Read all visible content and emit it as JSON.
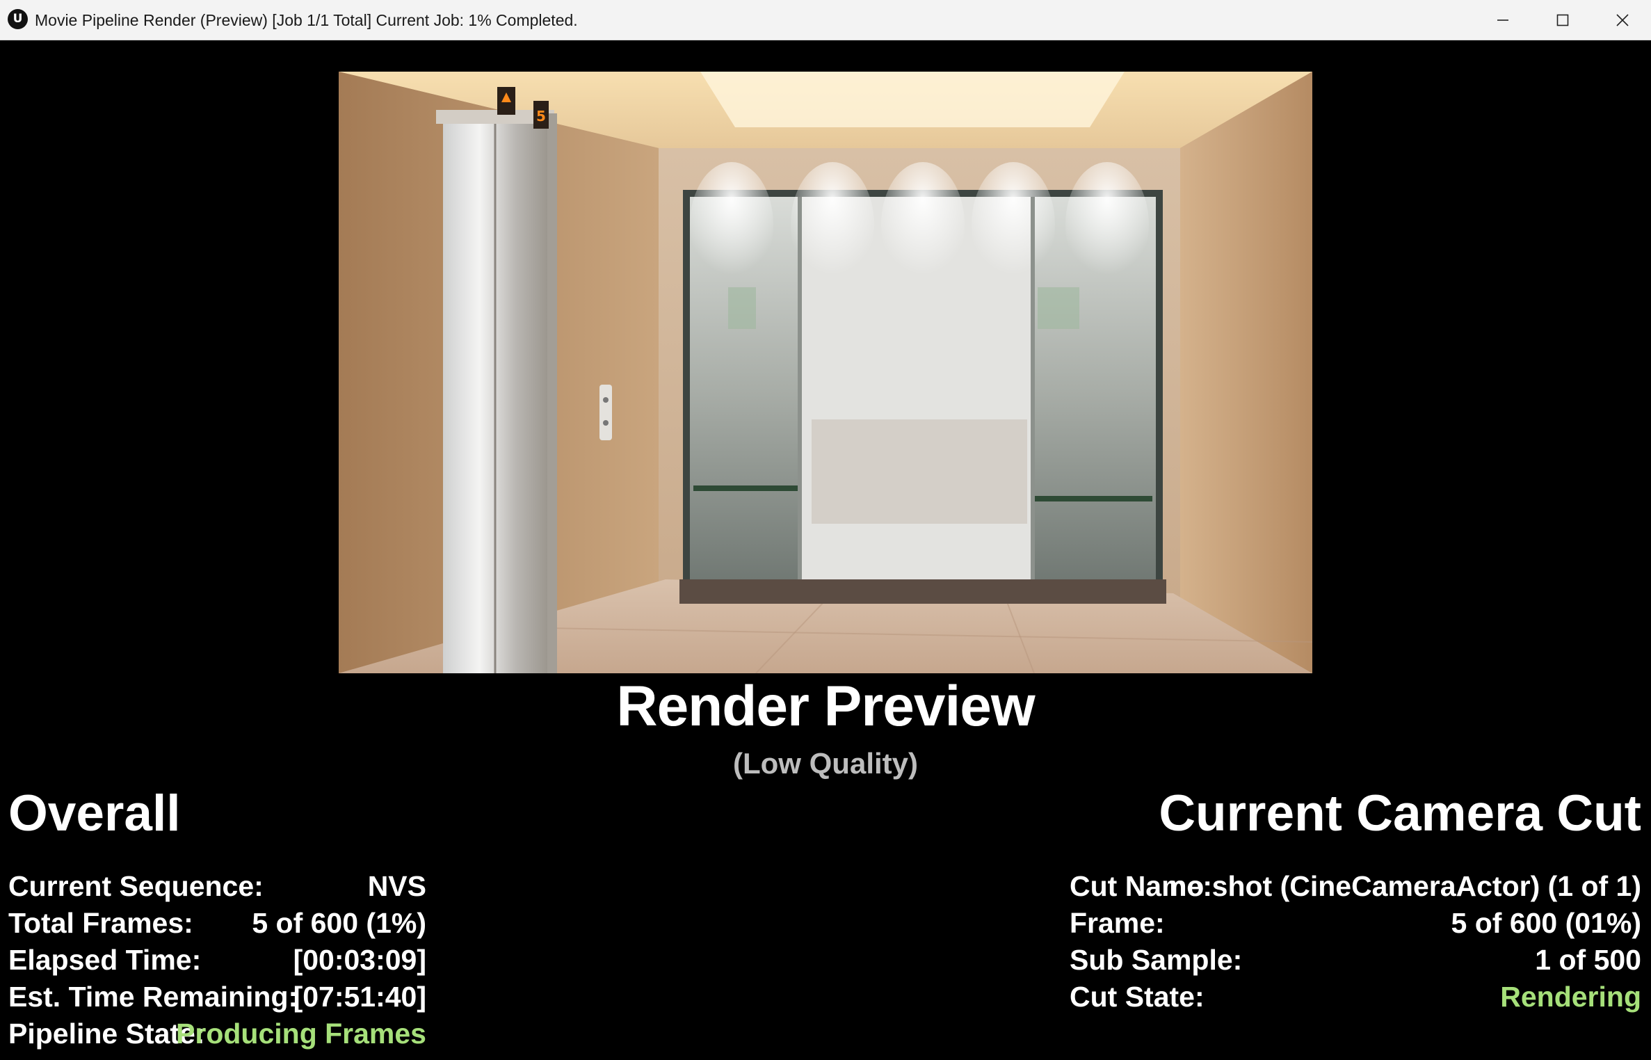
{
  "window": {
    "title": "Movie Pipeline Render (Preview) [Job 1/1 Total] Current Job: 1% Completed.",
    "logo_icon": "unreal-engine-logo-icon",
    "logo_glyph": "U",
    "controls": {
      "minimize_icon": "minimize-icon",
      "maximize_icon": "maximize-icon",
      "close_icon": "close-icon"
    }
  },
  "preview": {
    "title": "Render Preview",
    "subtitle": "(Low Quality)",
    "floor_indicator": "5"
  },
  "overall": {
    "heading": "Overall",
    "rows": [
      {
        "label": "Current Sequence:",
        "value": "NVS"
      },
      {
        "label": "Total Frames:",
        "value": "5 of 600 (1%)"
      },
      {
        "label": "Elapsed Time:",
        "value": "[00:03:09]"
      },
      {
        "label": "Est. Time Remaining:",
        "value": "[07:51:40]"
      },
      {
        "label": "Pipeline State:",
        "value": "Producing Frames"
      }
    ]
  },
  "camera_cut": {
    "heading": "Current Camera Cut",
    "rows": [
      {
        "label": "Cut Name:",
        "value": "no shot (CineCameraActor) (1 of 1)"
      },
      {
        "label": "Frame:",
        "value": "5 of 600 (01%)"
      },
      {
        "label": "Sub Sample:",
        "value": "1 of 500"
      },
      {
        "label": "Cut State:",
        "value": "Rendering"
      }
    ]
  },
  "colors": {
    "status_green": "#a6e07a",
    "background": "#000000",
    "titlebar": "#f3f3f3"
  }
}
